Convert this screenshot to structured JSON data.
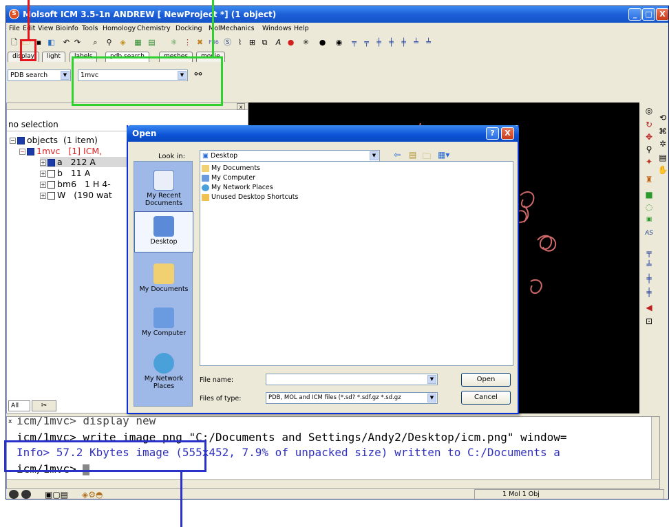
{
  "window": {
    "title": "Molsoft ICM 3.5-1n ANDREW [ NewProject *] (1 object)",
    "min": "_",
    "max": "□",
    "close": "X"
  },
  "menu": [
    "File",
    "Edit",
    "View",
    "Bioinfo",
    "Tools",
    "Homology",
    "Chemistry",
    "Docking",
    "MolMechanics",
    "Windows",
    "Help"
  ],
  "tabs": [
    "display",
    "light",
    "labels",
    "pdb search",
    "meshes",
    "movie"
  ],
  "search": {
    "mode": "PDB search",
    "query": "1mvc"
  },
  "left_pane": {
    "selection": "no selection",
    "tree": [
      {
        "label": "objects",
        "detail": "(1 item)"
      },
      {
        "label": "1mvc",
        "detail": "[1] ICM,"
      },
      {
        "label": "a",
        "detail": "212 A"
      },
      {
        "label": "b",
        "detail": "11 A"
      },
      {
        "label": "bm6",
        "detail": "1 H 4-"
      },
      {
        "label": "W",
        "detail": "(190 wat"
      }
    ],
    "tabs": [
      "All"
    ]
  },
  "dialog": {
    "title": "Open",
    "help": "?",
    "close": "X",
    "look_in_label": "Look in:",
    "look_in_value": "Desktop",
    "places": [
      "My Recent Documents",
      "Desktop",
      "My Documents",
      "My Computer",
      "My Network Places"
    ],
    "files": [
      "My Documents",
      "My Computer",
      "My Network Places",
      "Unused Desktop Shortcuts"
    ],
    "file_name_label": "File name:",
    "file_name_value": "",
    "file_type_label": "Files of type:",
    "file_type_value": "PDB, MOL and ICM files (*.sd? *.sdf.gz *.sd.gz",
    "open_button": "Open",
    "cancel_button": "Cancel"
  },
  "console": {
    "lines": [
      "icm/1mvc> display new",
      "icm/1mvc> write image png \"C:/Documents and Settings/Andy2/Desktop/icm.png\" window=",
      " Info> 57.2 Kbytes image (555x452, 7.9% of unpacked size) written to C:/Documents a",
      "icm/1mvc> "
    ]
  },
  "status": {
    "text": "1 Mol 1 Obj"
  },
  "colors": {
    "annot_red": "#e8141c",
    "annot_green": "#2ed12e",
    "annot_blue": "#2a31c8",
    "ribbon": "#d06a6a",
    "tree_red": "#e02020",
    "info_blue": "#3030c0"
  }
}
